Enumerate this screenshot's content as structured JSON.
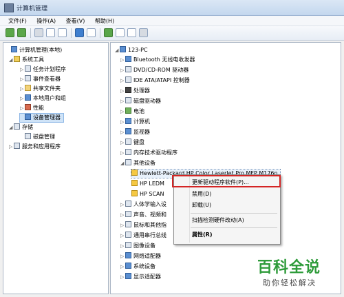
{
  "window": {
    "title": "计算机管理"
  },
  "menu": [
    "文件(F)",
    "操作(A)",
    "查看(V)",
    "帮助(H)"
  ],
  "left_tree": [
    {
      "label": "计算机管理(本地)",
      "expander": "",
      "icon": "computer-icon",
      "color": "blue"
    },
    {
      "label": "系统工具",
      "expander": "◢",
      "icon": "tools-icon",
      "color": "yellow"
    },
    {
      "label": "任务计划程序",
      "expander": "▷",
      "icon": "clock-icon",
      "color": ""
    },
    {
      "label": "事件查看器",
      "expander": "▷",
      "icon": "event-icon",
      "color": ""
    },
    {
      "label": "共享文件夹",
      "expander": "▷",
      "icon": "folder-icon",
      "color": "folder"
    },
    {
      "label": "本地用户和组",
      "expander": "▷",
      "icon": "users-icon",
      "color": "blue"
    },
    {
      "label": "性能",
      "expander": "▷",
      "icon": "performance-icon",
      "color": "red"
    },
    {
      "label": "设备管理器",
      "expander": "",
      "icon": "device-manager-icon",
      "color": "blue",
      "selected": true
    },
    {
      "label": "存储",
      "expander": "◢",
      "icon": "storage-icon",
      "color": ""
    },
    {
      "label": "磁盘管理",
      "expander": "",
      "icon": "disk-icon",
      "color": ""
    },
    {
      "label": "服务和应用程序",
      "expander": "▷",
      "icon": "services-icon",
      "color": ""
    }
  ],
  "device_tree": [
    {
      "label": "123-PC",
      "expander": "◢",
      "icon": "computer-icon",
      "color": "blue"
    },
    {
      "label": "Bluetooth 无线电收发器",
      "expander": "▷",
      "icon": "bluetooth-icon",
      "color": "blue"
    },
    {
      "label": "DVD/CD-ROM 驱动器",
      "expander": "▷",
      "icon": "dvd-icon",
      "color": ""
    },
    {
      "label": "IDE ATA/ATAPI 控制器",
      "expander": "▷",
      "icon": "ide-icon",
      "color": ""
    },
    {
      "label": "处理器",
      "expander": "▷",
      "icon": "cpu-icon",
      "color": "dark"
    },
    {
      "label": "磁盘驱动器",
      "expander": "▷",
      "icon": "disk-icon",
      "color": ""
    },
    {
      "label": "电池",
      "expander": "▷",
      "icon": "battery-icon",
      "color": "green"
    },
    {
      "label": "计算机",
      "expander": "▷",
      "icon": "computer-icon",
      "color": "blue"
    },
    {
      "label": "监视器",
      "expander": "▷",
      "icon": "monitor-icon",
      "color": "blue"
    },
    {
      "label": "键盘",
      "expander": "▷",
      "icon": "keyboard-icon",
      "color": ""
    },
    {
      "label": "内存技术驱动程序",
      "expander": "▷",
      "icon": "memory-icon",
      "color": ""
    },
    {
      "label": "其他设备",
      "expander": "◢",
      "icon": "other-devices-icon",
      "color": ""
    },
    {
      "label": "Hewlett-Packard HP Color LaserJet Pro MFP M176n",
      "expander": "",
      "icon": "warning-device-icon",
      "color": "warn",
      "highlighted": true
    },
    {
      "label": "HP LEDM",
      "expander": "",
      "icon": "warning-device-icon",
      "color": "warn"
    },
    {
      "label": "HP SCAN",
      "expander": "",
      "icon": "warning-device-icon",
      "color": "warn"
    },
    {
      "label": "人体学输入设",
      "expander": "▷",
      "icon": "hid-icon",
      "color": ""
    },
    {
      "label": "声音、视频和",
      "expander": "▷",
      "icon": "sound-icon",
      "color": ""
    },
    {
      "label": "鼠标和其他指",
      "expander": "▷",
      "icon": "mouse-icon",
      "color": ""
    },
    {
      "label": "通用串行总线",
      "expander": "▷",
      "icon": "usb-icon",
      "color": ""
    },
    {
      "label": "图像设备",
      "expander": "▷",
      "icon": "camera-icon",
      "color": ""
    },
    {
      "label": "网络适配器",
      "expander": "▷",
      "icon": "network-icon",
      "color": "blue"
    },
    {
      "label": "系统设备",
      "expander": "▷",
      "icon": "system-device-icon",
      "color": "blue"
    },
    {
      "label": "显示适配器",
      "expander": "▷",
      "icon": "display-adapter-icon",
      "color": "blue"
    }
  ],
  "context_menu": [
    {
      "label": "更新驱动程序软件(P)...",
      "name": "menu-update-driver",
      "bold": false
    },
    {
      "label": "禁用(D)",
      "name": "menu-disable",
      "bold": false
    },
    {
      "label": "卸载(U)",
      "name": "menu-uninstall",
      "bold": false
    },
    {
      "label": "扫描检测硬件改动(A)",
      "name": "menu-scan-hardware",
      "bold": false
    },
    {
      "label": "属性(R)",
      "name": "menu-properties",
      "bold": true
    }
  ],
  "watermark": {
    "title": "百科全说",
    "subtitle": "助你轻松解决"
  }
}
